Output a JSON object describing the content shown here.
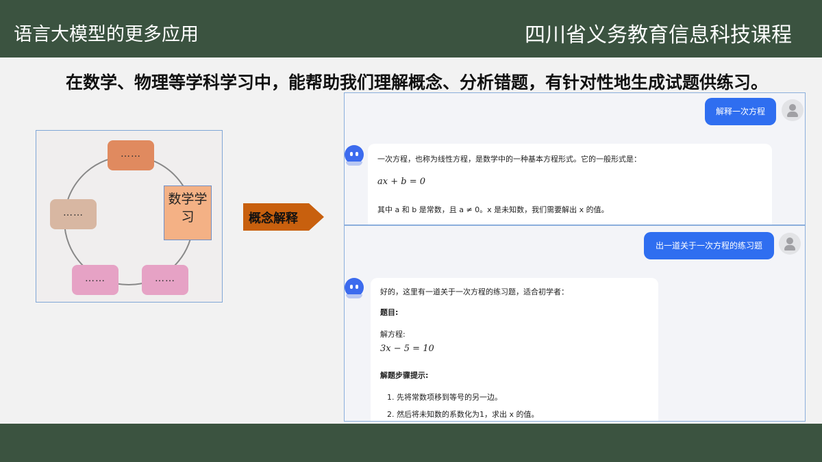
{
  "header": {
    "left_title": "语言大模型的更多应用",
    "right_title": "四川省义务教育信息科技课程"
  },
  "intro_text": "在数学、物理等学科学习中，能帮助我们理解概念、分析错题，有针对性地生成试题供练习。",
  "diagram": {
    "nodes": [
      "……",
      "……",
      "……",
      "……"
    ],
    "center_label": "数学学习"
  },
  "arrow_label": "概念解释",
  "chat1": {
    "user_message": "解释一次方程",
    "bot_lines": [
      "一次方程，也称为线性方程，是数学中的一种基本方程形式。它的一般形式是：",
      "ax + b = 0",
      "其中 a 和 b 是常数，且 a ≠ 0。x 是未知数，我们需要解出 x 的值。"
    ]
  },
  "chat2": {
    "user_message": "出一道关于一次方程的练习题",
    "bot_lines": [
      "好的，这里有一道关于一次方程的练习题，适合初学者：",
      "题目:",
      "解方程:",
      "3x − 5 = 10",
      "解题步骤提示:",
      "1. 先将常数项移到等号的另一边。",
      "2. 然后将未知数的系数化为1，求出 x 的值。"
    ]
  },
  "colors": {
    "header_bg": "#3b5340",
    "accent_blue": "#2f6ef0",
    "arrow_orange": "#c8600e"
  }
}
